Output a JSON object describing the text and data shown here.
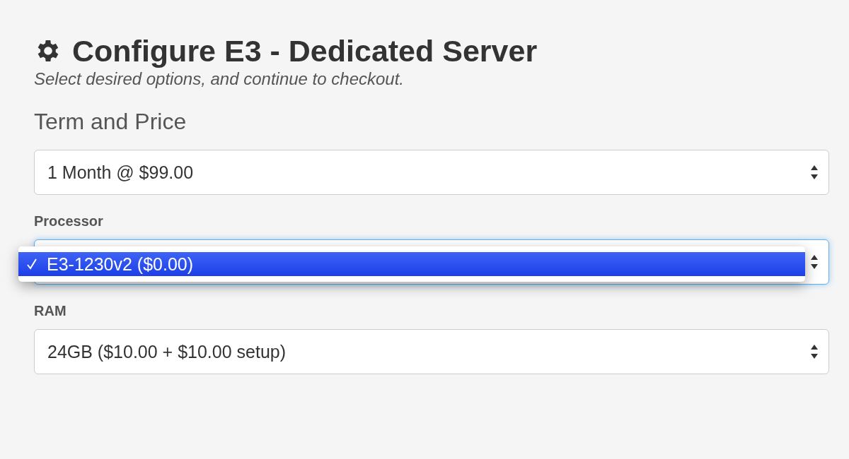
{
  "title": "Configure E3 - Dedicated Server",
  "subtitle": "Select desired options, and continue to checkout.",
  "section_heading": "Term and Price",
  "fields": [
    {
      "value": "1 Month @ $99.00",
      "focused": false
    },
    {
      "label": "Processor",
      "focused": true,
      "menu": [
        {
          "label": "E3-1230v2 ($0.00)",
          "selected": true
        }
      ]
    },
    {
      "label": "RAM",
      "value": "24GB ($10.00 + $10.00 setup)",
      "focused": false
    }
  ]
}
